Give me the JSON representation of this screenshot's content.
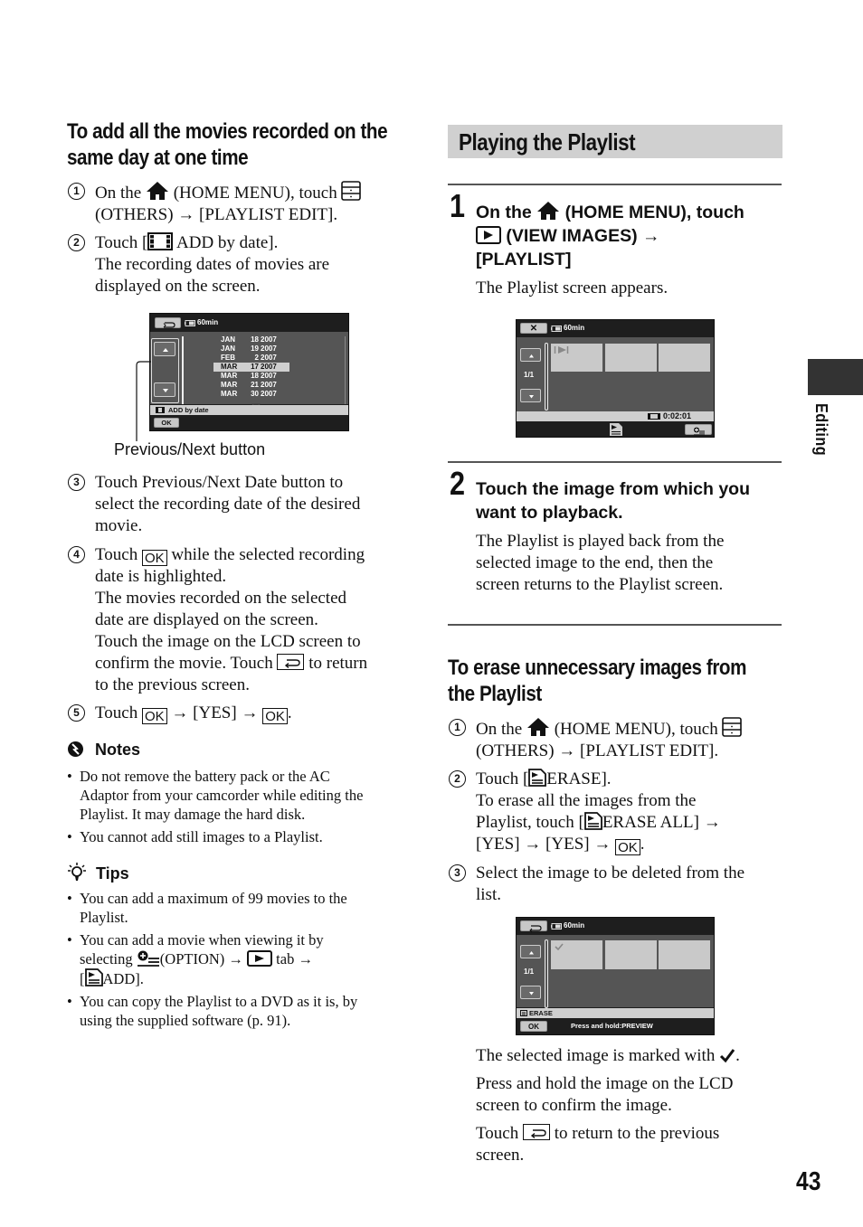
{
  "left": {
    "heading": [
      "To add all the movies recorded on the",
      "same day at one time"
    ],
    "steps": [
      {
        "num": "1",
        "lines": [
          "On the",
          "(HOME MENU), touch",
          "(OTHERS) → [PLAYLIST EDIT]."
        ]
      },
      {
        "num": "2",
        "lines": [
          "Touch [",
          "ADD by date].",
          "The recording dates of movies are",
          "displayed on the screen."
        ]
      },
      {
        "num": "3",
        "lines": [
          "Touch Previous/Next Date button to",
          "select the recording date of the desired",
          "movie."
        ]
      },
      {
        "num": "4",
        "lines": [
          "Touch",
          "while the selected recording",
          "date is highlighted.",
          "The movies recorded on the selected",
          "date are displayed on the screen.",
          "Touch the image on the LCD screen to",
          "confirm the movie. Touch",
          "to return",
          "to the previous screen."
        ]
      },
      {
        "num": "5",
        "lines": [
          "Touch",
          "→ [YES] →",
          "."
        ]
      }
    ],
    "ok_label": "OK",
    "screen1": {
      "battery": "60min",
      "dates": [
        {
          "month": "JAN",
          "day": "18",
          "year": "2007",
          "selected": false
        },
        {
          "month": "JAN",
          "day": "19",
          "year": "2007",
          "selected": false
        },
        {
          "month": "FEB",
          "day": "2",
          "year": "2007",
          "selected": false
        },
        {
          "month": "MAR",
          "day": "17",
          "year": "2007",
          "selected": true
        },
        {
          "month": "MAR",
          "day": "18",
          "year": "2007",
          "selected": false
        },
        {
          "month": "MAR",
          "day": "21",
          "year": "2007",
          "selected": false
        },
        {
          "month": "MAR",
          "day": "30",
          "year": "2007",
          "selected": false
        }
      ],
      "status": "ADD by date",
      "ok": "OK"
    },
    "callout": "Previous/Next button",
    "notes": {
      "title": "Notes",
      "items": [
        [
          "Do not remove the battery pack or the AC",
          "Adaptor from your camcorder while editing the",
          "Playlist. It may damage the hard disk."
        ],
        [
          "You cannot add still images to a Playlist."
        ]
      ]
    },
    "tips": {
      "title": "Tips",
      "items": [
        [
          "You can add a maximum of 99 movies to the",
          "Playlist."
        ],
        [
          "You can add a movie when viewing it by",
          "selecting",
          "(OPTION) →",
          "tab →",
          "[",
          "ADD]."
        ],
        [
          "You can copy the Playlist to a DVD as it is, by",
          "using the supplied software (p. 91)."
        ]
      ]
    }
  },
  "right": {
    "section_title": "Playing the Playlist",
    "step1": {
      "num": "1",
      "lines": [
        "On the",
        "(HOME MENU), touch",
        "(VIEW IMAGES) →",
        "[PLAYLIST]"
      ],
      "body": "The Playlist screen appears."
    },
    "screen2": {
      "close": "✕",
      "battery": "60min",
      "page": "1/1",
      "timecode": "0:02:01"
    },
    "step2": {
      "num": "2",
      "lines": [
        "Touch the image from which you",
        "want to playback."
      ],
      "body": [
        "The Playlist is played back from the",
        "selected image to the end, then the",
        "screen returns to the Playlist screen."
      ]
    },
    "erase": {
      "heading": [
        "To erase unnecessary images from",
        "the Playlist"
      ],
      "steps": [
        {
          "num": "1",
          "lines": [
            "On the",
            "(HOME MENU), touch",
            "(OTHERS) → [PLAYLIST EDIT]."
          ]
        },
        {
          "num": "2",
          "lines": [
            "Touch [",
            "ERASE].",
            "To erase all the images from the",
            "Playlist, touch [",
            "ERASE ALL] →",
            "[YES] → [YES] →",
            "."
          ]
        },
        {
          "num": "3",
          "lines": [
            "Select the image to be deleted from the",
            "list."
          ]
        }
      ]
    },
    "screen3": {
      "battery": "60min",
      "page": "1/1",
      "status": "ERASE",
      "ok": "OK",
      "hint": "Press and hold:PREVIEW"
    },
    "after": [
      [
        "The selected image is marked with",
        "."
      ],
      [
        "Press and hold the image on the LCD",
        "screen to confirm the image."
      ],
      [
        "Touch",
        "to return to the previous",
        "screen."
      ]
    ]
  },
  "side_tab": "Editing",
  "page_number": "43"
}
